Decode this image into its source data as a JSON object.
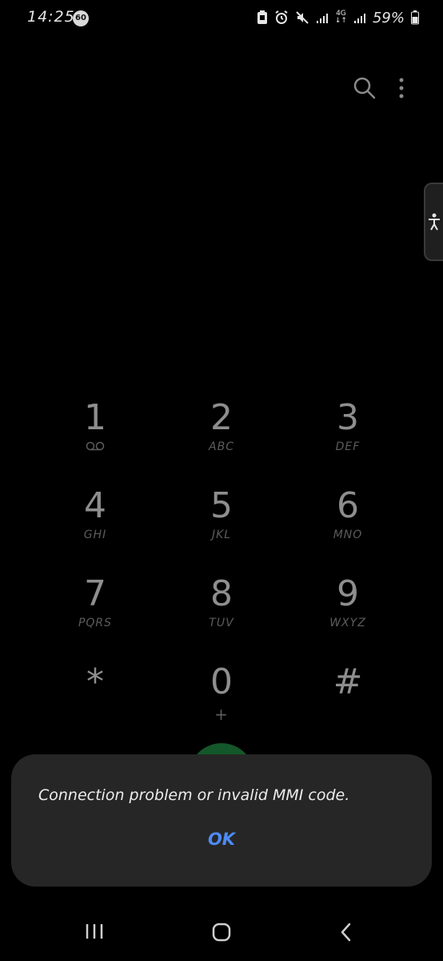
{
  "status_bar": {
    "time": "14:25",
    "badge": "60",
    "network_label_top": "4G",
    "battery_percent": "59%"
  },
  "top_bar": {
    "icons": [
      "search-icon",
      "more-vertical-icon"
    ]
  },
  "edge_panel": {
    "icon": "accessibility-icon"
  },
  "keypad": {
    "keys": [
      {
        "digit": "1",
        "letters": ""
      },
      {
        "digit": "2",
        "letters": "ABC"
      },
      {
        "digit": "3",
        "letters": "DEF"
      },
      {
        "digit": "4",
        "letters": "GHI"
      },
      {
        "digit": "5",
        "letters": "JKL"
      },
      {
        "digit": "6",
        "letters": "MNO"
      },
      {
        "digit": "7",
        "letters": "PQRS"
      },
      {
        "digit": "8",
        "letters": "TUV"
      },
      {
        "digit": "9",
        "letters": "WXYZ"
      },
      {
        "digit": "*",
        "letters": ""
      },
      {
        "digit": "0",
        "letters": "+"
      },
      {
        "digit": "#",
        "letters": ""
      }
    ]
  },
  "dialog": {
    "message": "Connection problem or invalid MMI code.",
    "ok_label": "OK"
  },
  "colors": {
    "background": "#000000",
    "dialog_bg": "#262626",
    "accent": "#4d8bf5",
    "call_green": "#14572a"
  }
}
